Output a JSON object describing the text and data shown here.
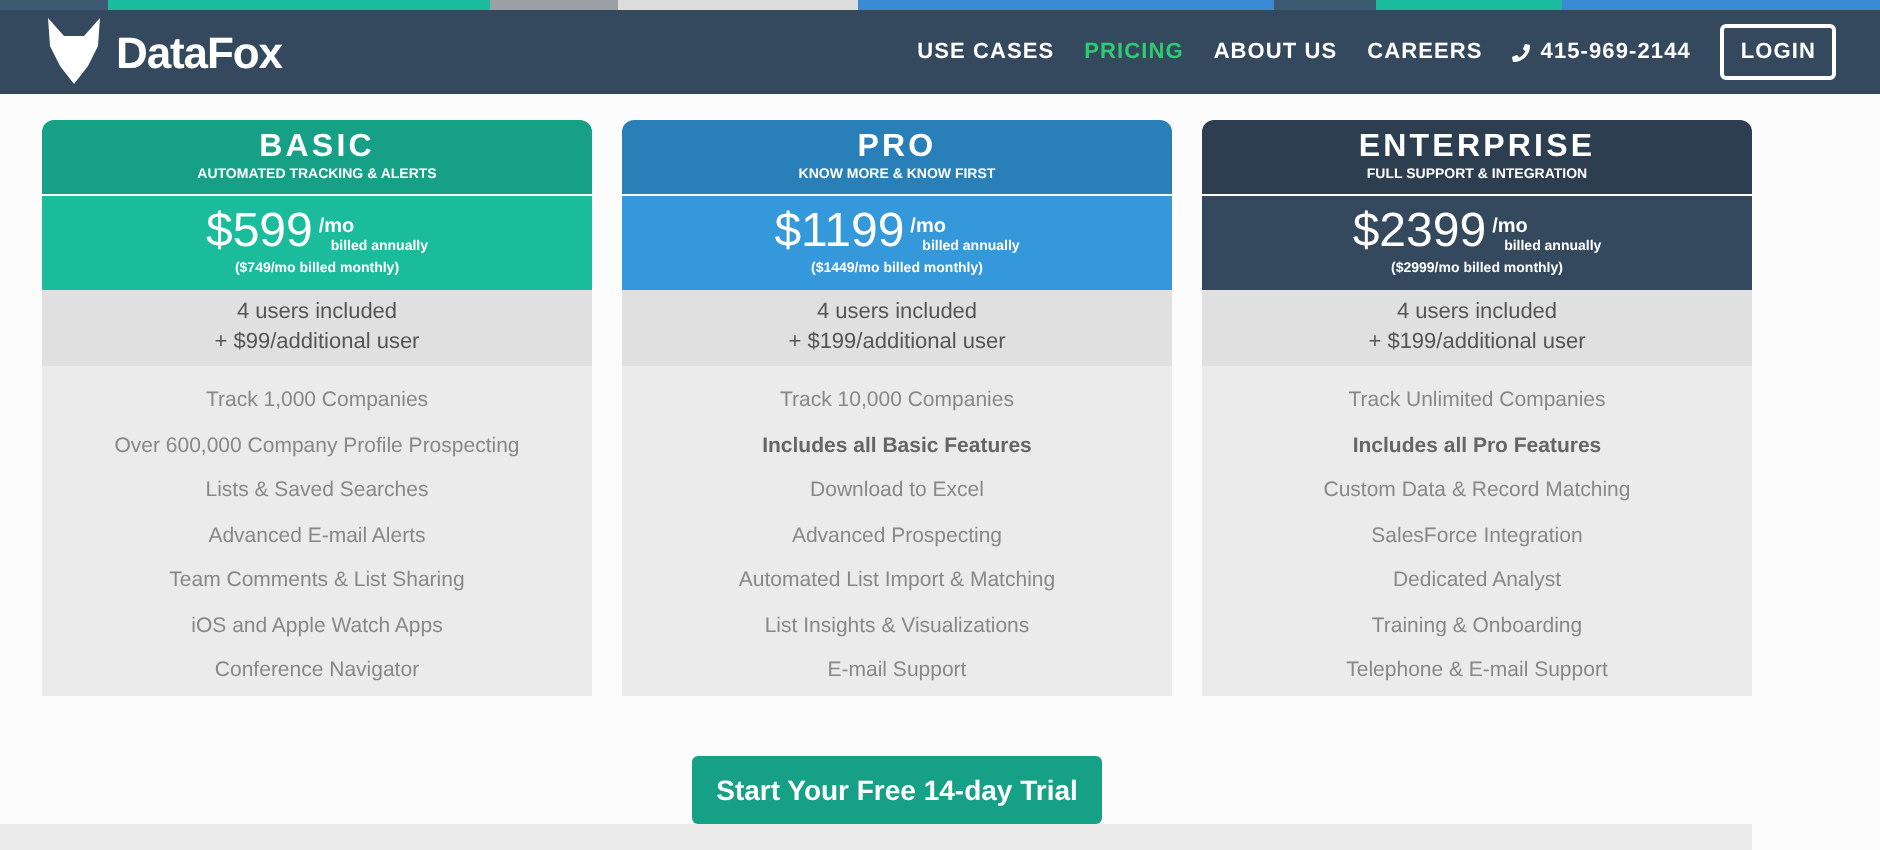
{
  "nav": {
    "logo": "DataFox",
    "links": [
      {
        "label": "USE CASES",
        "selected": false
      },
      {
        "label": "PRICING",
        "selected": true
      },
      {
        "label": "ABOUT US",
        "selected": false
      },
      {
        "label": "CAREERS",
        "selected": false
      }
    ],
    "phone": "415-969-2144",
    "login": "LOGIN"
  },
  "plans": [
    {
      "kind": "basic",
      "name": "BASIC",
      "tagline": "AUTOMATED TRACKING & ALERTS",
      "price": "$599",
      "per": "/mo",
      "billing": "billed annually",
      "monthly": "($749/mo billed monthly)",
      "users": "4 users included",
      "extra": "+ $99/additional user",
      "features": [
        {
          "text": "Track 1,000 Companies",
          "bold": false
        },
        {
          "text": "Over 600,000 Company Profile Prospecting",
          "bold": false
        },
        {
          "text": "Lists & Saved Searches",
          "bold": false
        },
        {
          "text": "Advanced E-mail Alerts",
          "bold": false
        },
        {
          "text": "Team Comments & List Sharing",
          "bold": false
        },
        {
          "text": "iOS and Apple Watch Apps",
          "bold": false
        },
        {
          "text": "Conference Navigator",
          "bold": false
        }
      ]
    },
    {
      "kind": "pro",
      "name": "PRO",
      "tagline": "KNOW MORE & KNOW FIRST",
      "price": "$1199",
      "per": "/mo",
      "billing": "billed annually",
      "monthly": "($1449/mo billed monthly)",
      "users": "4 users included",
      "extra": "+ $199/additional user",
      "features": [
        {
          "text": "Track 10,000 Companies",
          "bold": false
        },
        {
          "text": "Includes all Basic Features",
          "bold": true
        },
        {
          "text": "Download to Excel",
          "bold": false
        },
        {
          "text": "Advanced Prospecting",
          "bold": false
        },
        {
          "text": "Automated List Import & Matching",
          "bold": false
        },
        {
          "text": "List Insights & Visualizations",
          "bold": false
        },
        {
          "text": "E-mail Support",
          "bold": false
        }
      ]
    },
    {
      "kind": "enterprise",
      "name": "ENTERPRISE",
      "tagline": "FULL SUPPORT & INTEGRATION",
      "price": "$2399",
      "per": "/mo",
      "billing": "billed annually",
      "monthly": "($2999/mo billed monthly)",
      "users": "4 users included",
      "extra": "+ $199/additional user",
      "features": [
        {
          "text": "Track Unlimited Companies",
          "bold": false
        },
        {
          "text": "Includes all Pro Features",
          "bold": true
        },
        {
          "text": "Custom Data & Record Matching",
          "bold": false
        },
        {
          "text": "SalesForce Integration",
          "bold": false
        },
        {
          "text": "Dedicated Analyst",
          "bold": false
        },
        {
          "text": "Training & Onboarding",
          "bold": false
        },
        {
          "text": "Telephone & E-mail Support",
          "bold": false
        }
      ]
    }
  ],
  "cta": "Start Your Free 14-day Trial"
}
